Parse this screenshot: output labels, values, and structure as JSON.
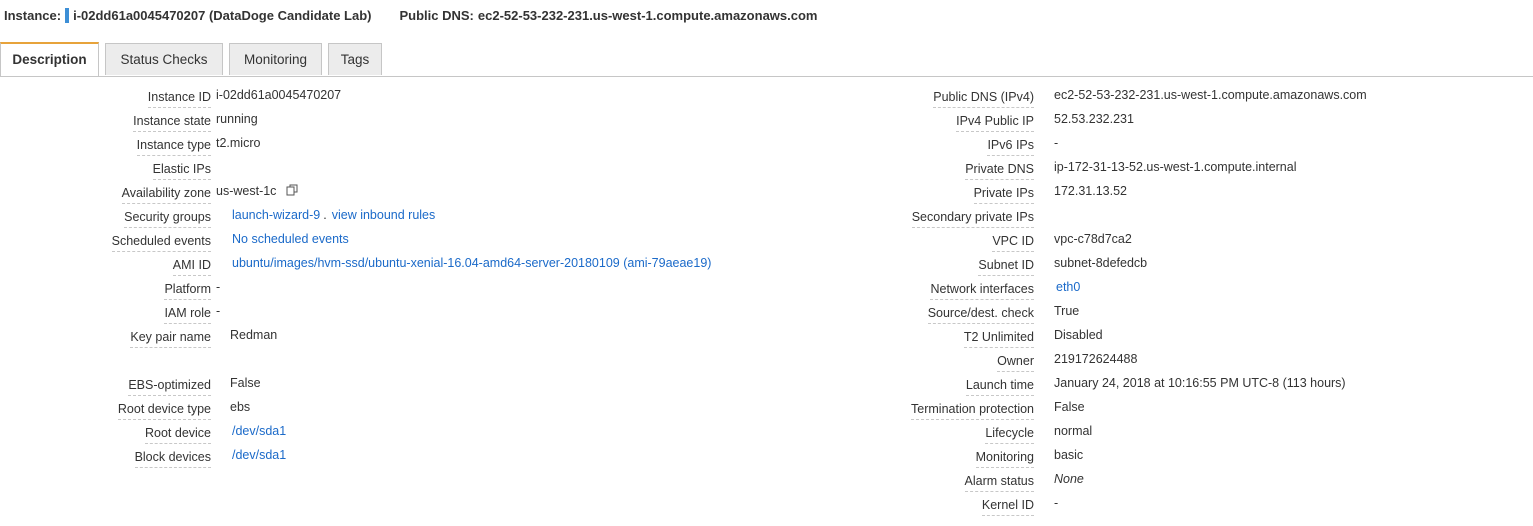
{
  "header": {
    "instance_label": "Instance:",
    "instance_id": "i-02dd61a0045470207 (DataDoge Candidate Lab)",
    "dns_label": "Public DNS:",
    "dns_value": "ec2-52-53-232-231.us-west-1.compute.amazonaws.com"
  },
  "tabs": [
    "Description",
    "Status Checks",
    "Monitoring",
    "Tags"
  ],
  "left": {
    "instance_id": {
      "label": "Instance ID",
      "value": "i-02dd61a0045470207"
    },
    "instance_state": {
      "label": "Instance state",
      "value": "running"
    },
    "instance_type": {
      "label": "Instance type",
      "value": "t2.micro"
    },
    "elastic_ips": {
      "label": "Elastic IPs",
      "value": ""
    },
    "availability_zone": {
      "label": "Availability zone",
      "value": "us-west-1c"
    },
    "security_groups": {
      "label": "Security groups",
      "link1": "launch-wizard-9",
      "sep": ".",
      "link2": "view inbound rules"
    },
    "scheduled_events": {
      "label": "Scheduled events",
      "value": "No scheduled events"
    },
    "ami_id": {
      "label": "AMI ID",
      "value": "ubuntu/images/hvm-ssd/ubuntu-xenial-16.04-amd64-server-20180109 (ami-79aeae19)"
    },
    "platform": {
      "label": "Platform",
      "value": "-"
    },
    "iam_role": {
      "label": "IAM role",
      "value": "-"
    },
    "key_pair": {
      "label": "Key pair name",
      "value": "Redman"
    },
    "ebs_optimized": {
      "label": "EBS-optimized",
      "value": "False"
    },
    "root_device_type": {
      "label": "Root device type",
      "value": "ebs"
    },
    "root_device": {
      "label": "Root device",
      "value": "/dev/sda1"
    },
    "block_devices": {
      "label": "Block devices",
      "value": "/dev/sda1"
    }
  },
  "right": {
    "public_dns": {
      "label": "Public DNS (IPv4)",
      "value": "ec2-52-53-232-231.us-west-1.compute.amazonaws.com"
    },
    "ipv4_public_ip": {
      "label": "IPv4 Public IP",
      "value": "52.53.232.231"
    },
    "ipv6_ips": {
      "label": "IPv6 IPs",
      "value": "-"
    },
    "private_dns": {
      "label": "Private DNS",
      "value": "ip-172-31-13-52.us-west-1.compute.internal"
    },
    "private_ips": {
      "label": "Private IPs",
      "value": "172.31.13.52"
    },
    "secondary_private_ips": {
      "label": "Secondary private IPs",
      "value": ""
    },
    "vpc_id": {
      "label": "VPC ID",
      "value": "vpc-c78d7ca2"
    },
    "subnet_id": {
      "label": "Subnet ID",
      "value": "subnet-8defedcb"
    },
    "network_interfaces": {
      "label": "Network interfaces",
      "value": "eth0"
    },
    "source_dest_check": {
      "label": "Source/dest. check",
      "value": "True"
    },
    "t2_unlimited": {
      "label": "T2 Unlimited",
      "value": "Disabled"
    },
    "owner": {
      "label": "Owner",
      "value": "219172624488"
    },
    "launch_time": {
      "label": "Launch time",
      "value": "January 24, 2018 at 10:16:55 PM UTC-8 (113 hours)"
    },
    "termination_protection": {
      "label": "Termination protection",
      "value": "False"
    },
    "lifecycle": {
      "label": "Lifecycle",
      "value": "normal"
    },
    "monitoring": {
      "label": "Monitoring",
      "value": "basic"
    },
    "alarm_status": {
      "label": "Alarm status",
      "value": "None"
    },
    "kernel_id": {
      "label": "Kernel ID",
      "value": "-"
    }
  },
  "colors": {
    "link": "#1b6ac9",
    "accent_tab": "#e7a33b",
    "header_bar": "#3d8fd6"
  },
  "icons": {
    "copy": "copy-icon"
  }
}
